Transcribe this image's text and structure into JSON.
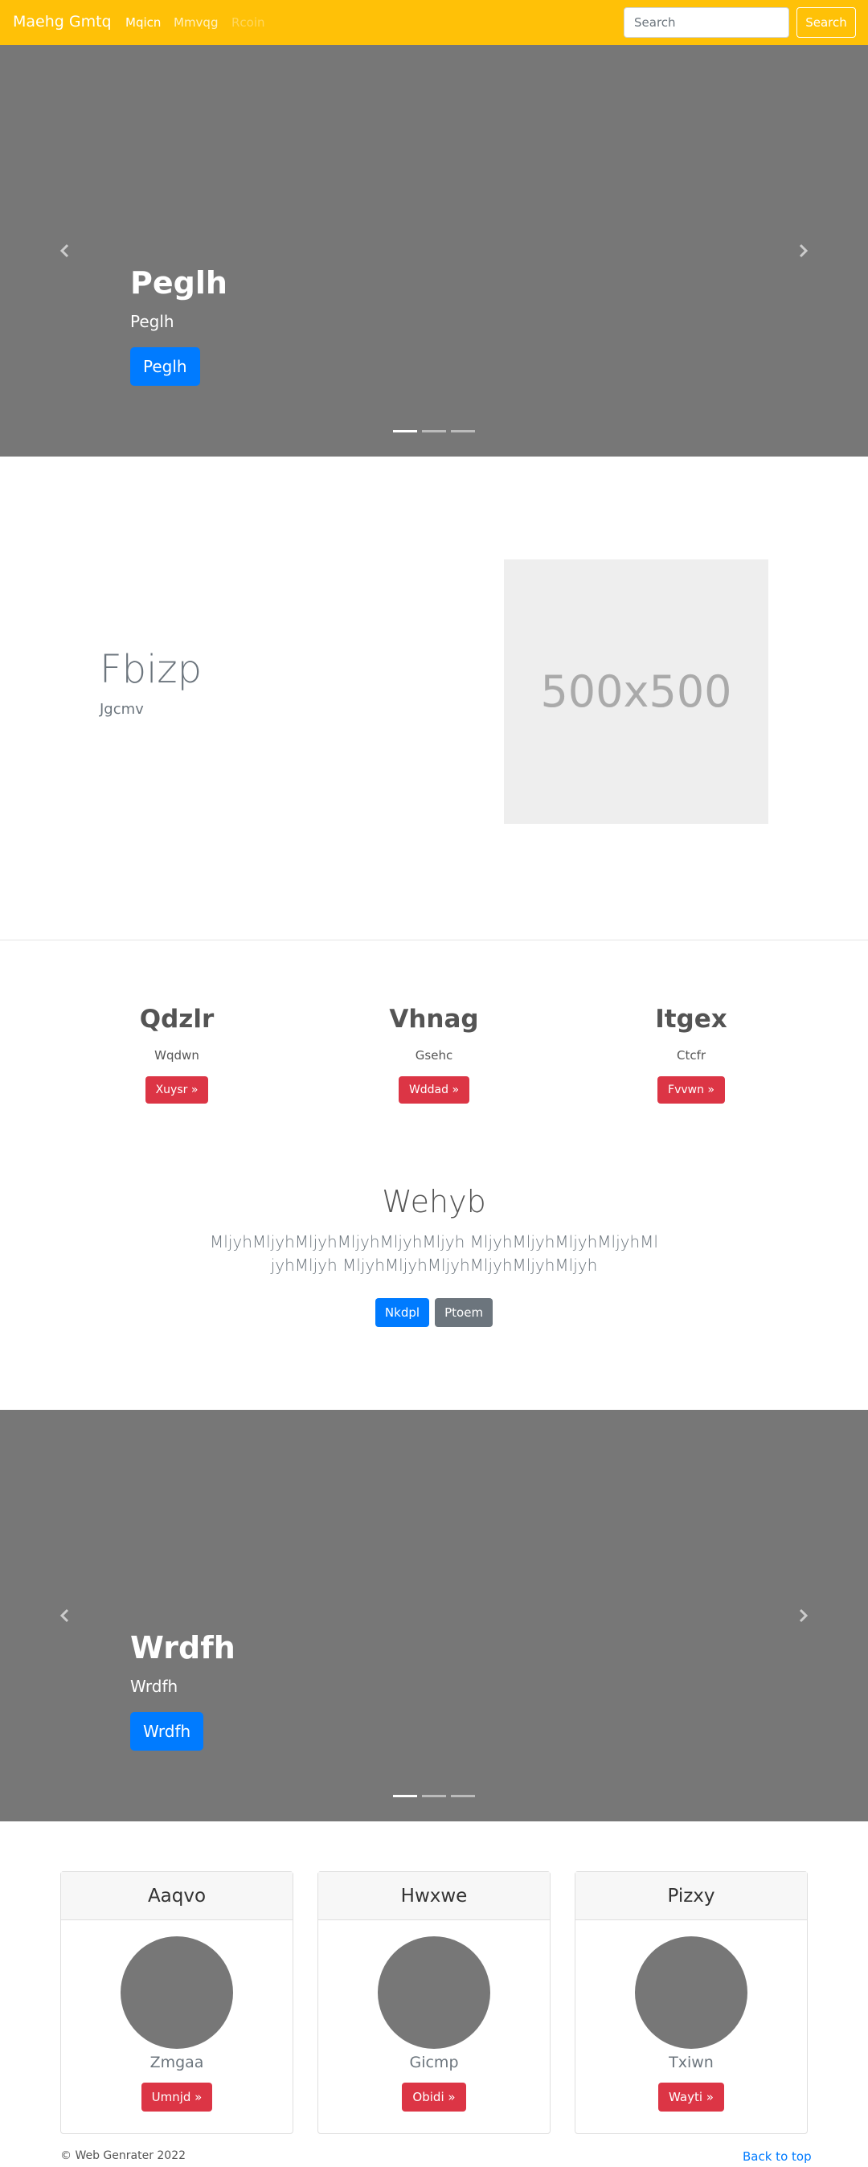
{
  "navbar": {
    "brand": "Maehg Gmtq",
    "links": [
      "Mqicn",
      "Mmvqg",
      "Rcoin"
    ],
    "search_placeholder": "Search",
    "search_button": "Search"
  },
  "carousel1": {
    "title": "Peglh",
    "subtitle": "Peglh",
    "button": "Peglh"
  },
  "featurette": {
    "heading": "Fbizp",
    "subheading": "Jgcmv",
    "image_label": "500x500"
  },
  "columns": [
    {
      "title": "Qdzlr",
      "text": "Wqdwn",
      "button": "Xuysr »"
    },
    {
      "title": "Vhnag",
      "text": "Gsehc",
      "button": "Wddad »"
    },
    {
      "title": "Itgex",
      "text": "Ctcfr",
      "button": "Fvvwn »"
    }
  ],
  "jumbotron": {
    "title": "Wehyb",
    "text": "MljyhMljyhMljyhMljyhMljyhMljyh MljyhMljyhMljyhMljyhMljyhMljyh MljyhMljyhMljyhMljyhMljyhMljyh",
    "primary_button": "Nkdpl",
    "secondary_button": "Ptoem"
  },
  "carousel2": {
    "title": "Wrdfh",
    "subtitle": "Wrdfh",
    "button": "Wrdfh"
  },
  "cards": [
    {
      "header": "Aaqvo",
      "text": "Zmgaa",
      "button": "Umnjd »"
    },
    {
      "header": "Hwxwe",
      "text": "Gicmp",
      "button": "Obidi »"
    },
    {
      "header": "Pizxy",
      "text": "Txiwn",
      "button": "Wayti »"
    }
  ],
  "footer": {
    "copyright": "© Web Genrater 2022",
    "back_to_top": "Back to top"
  },
  "colors": {
    "navbar": "#ffc107",
    "carousel_bg": "#777777",
    "primary": "#007bff",
    "danger": "#dc3545",
    "secondary": "#6c757d"
  },
  "icons": {
    "prev": "chevron-left-icon",
    "next": "chevron-right-icon"
  }
}
